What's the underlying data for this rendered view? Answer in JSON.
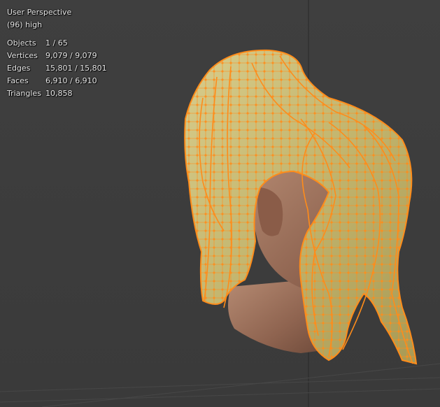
{
  "viewport": {
    "view_name": "User Perspective",
    "object_info": "(96) high"
  },
  "stats": [
    {
      "label": "Objects",
      "value": "1 / 65"
    },
    {
      "label": "Vertices",
      "value": "9,079 / 9,079"
    },
    {
      "label": "Edges",
      "value": "15,801 / 15,801"
    },
    {
      "label": "Faces",
      "value": "6,910 / 6,910"
    },
    {
      "label": "Triangles",
      "value": "10,858"
    }
  ],
  "colors": {
    "background": "#3d3d3d",
    "grid": "#474747",
    "selection": "#ff8c1a",
    "hair": "#c9bd7a",
    "skin": "#9a6e58"
  },
  "icons": {
    "model": "head-with-hair-mesh"
  }
}
